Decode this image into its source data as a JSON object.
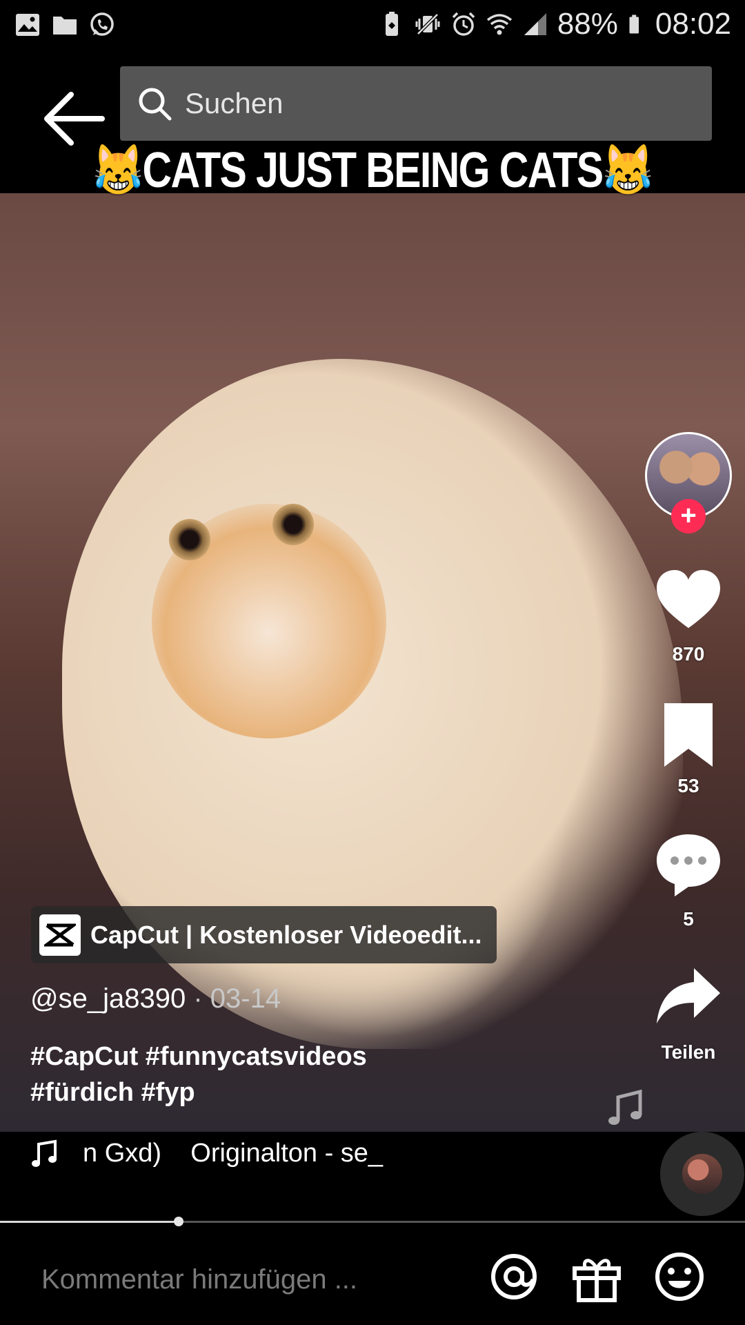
{
  "status_bar": {
    "left_icons": [
      "gallery-icon",
      "folder-icon",
      "whatsapp-icon"
    ],
    "right_icons": [
      "battery-saver-icon",
      "mute-vibrate-icon",
      "alarm-icon",
      "wifi-icon",
      "signal-icon"
    ],
    "battery_percent": "88%",
    "time": "08:02"
  },
  "header": {
    "back_icon": "back-arrow-icon",
    "search_placeholder": "Suchen"
  },
  "video": {
    "title_text": "CATS JUST BEING CATS",
    "title_emoji": "😹"
  },
  "rail": {
    "like_count": "870",
    "favorite_count": "53",
    "comment_count": "5",
    "share_label": "Teilen"
  },
  "capcut": {
    "label": "CapCut | Kostenloser Videoedit..."
  },
  "post": {
    "author": "@se_ja8390",
    "separator": " · ",
    "date": "03-14",
    "caption_line1": "#CapCut #funnycatsvideos",
    "caption_line2": "#fürdich #fyp"
  },
  "music": {
    "text": "n Gxd)    Originalton - se_"
  },
  "progress": {
    "fraction": 0.24
  },
  "comment": {
    "placeholder": "Kommentar hinzufügen ..."
  },
  "colors": {
    "accent": "#fe2c55",
    "search_bg": "#555555"
  }
}
